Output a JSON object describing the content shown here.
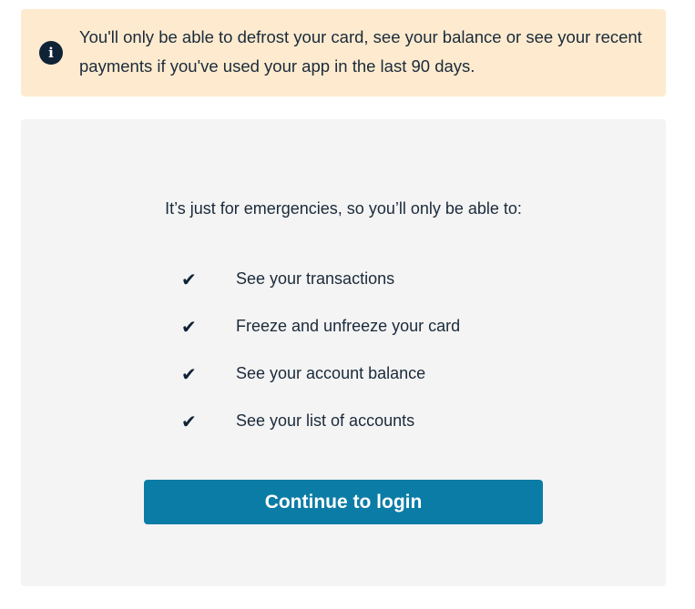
{
  "notice": {
    "icon": "info-icon",
    "icon_glyph": "i",
    "text": "You'll only be able to defrost your card, see your balance or see your recent payments if you've used your app in the last 90 days."
  },
  "panel": {
    "intro": "It’s just for emergencies, so you’ll only be able to:",
    "features": [
      {
        "icon": "checkmark-icon",
        "glyph": "✔",
        "label": "See your transactions"
      },
      {
        "icon": "checkmark-icon",
        "glyph": "✔",
        "label": "Freeze and unfreeze your card"
      },
      {
        "icon": "checkmark-icon",
        "glyph": "✔",
        "label": "See your account balance"
      },
      {
        "icon": "checkmark-icon",
        "glyph": "✔",
        "label": "See your list of accounts"
      }
    ],
    "button_label": "Continue to login"
  },
  "colors": {
    "notice_background": "#feebcf",
    "panel_background": "#f4f4f4",
    "button_background": "#0b7ca6",
    "text": "#1b2a3a",
    "icon": "#0f2236"
  }
}
